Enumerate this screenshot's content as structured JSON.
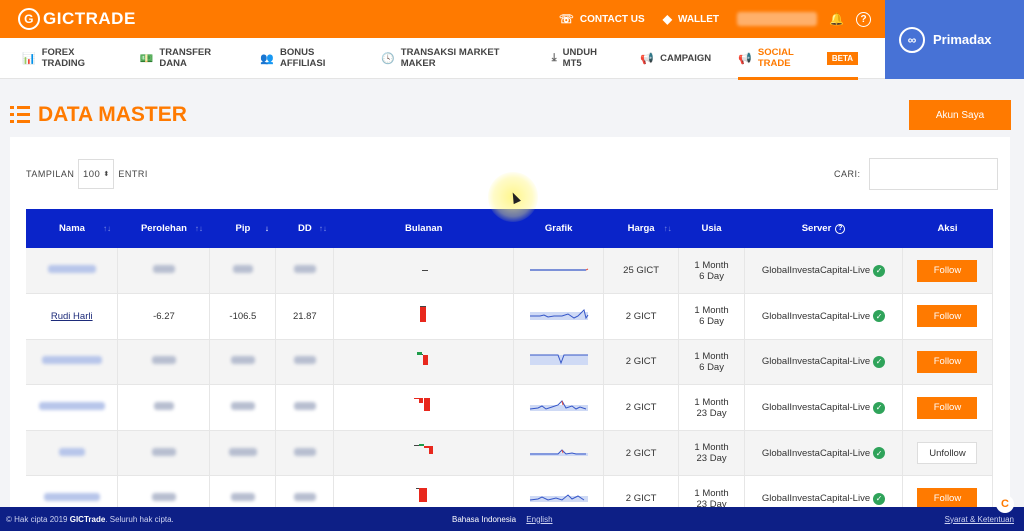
{
  "brand": {
    "logo_text": "GICTRADE",
    "accent": "#ff7a00",
    "table_header_bg": "#0a24c9"
  },
  "topbar": {
    "contact_label": "CONTACT US",
    "wallet_label": "WALLET"
  },
  "primadax": {
    "label": "Primadax"
  },
  "nav": [
    {
      "label": "FOREX TRADING",
      "icon": "chart-icon",
      "glyph": "📊"
    },
    {
      "label": "TRANSFER DANA",
      "icon": "money-icon",
      "glyph": "💵"
    },
    {
      "label": "BONUS AFFILIASI",
      "icon": "users-icon",
      "glyph": "👥"
    },
    {
      "label": "TRANSAKSI MARKET MAKER",
      "icon": "history-icon",
      "glyph": "🕓"
    },
    {
      "label": "UNDUH MT5",
      "icon": "download-icon",
      "glyph": "⤓"
    },
    {
      "label": "CAMPAIGN",
      "icon": "megaphone-icon",
      "glyph": "📢"
    },
    {
      "label": "SOCIAL TRADE",
      "icon": "megaphone-icon",
      "glyph": "📢",
      "badge": "BETA",
      "active": true
    }
  ],
  "page": {
    "title": "DATA MASTER",
    "account_button": "Akun Saya"
  },
  "controls": {
    "show_label": "TAMPILAN",
    "page_size": "100",
    "entries_label": "ENTRI",
    "search_label": "CARI:"
  },
  "table": {
    "columns": [
      "Nama",
      "Perolehan",
      "Pip",
      "DD",
      "Bulanan",
      "Grafik",
      "Harga",
      "Usia",
      "Server",
      "Aksi"
    ],
    "rows": [
      {
        "name": "",
        "perolehan": "",
        "pip": "",
        "dd": "",
        "price": "25 GICT",
        "age_1": "1 Month",
        "age_2": "6 Day",
        "server": "GlobalInvestaCapital-Live",
        "action": "Follow"
      },
      {
        "name": "Rudi Harli",
        "perolehan": "-6.27",
        "pip": "-106.5",
        "dd": "21.87",
        "price": "2 GICT",
        "age_1": "1 Month",
        "age_2": "6 Day",
        "server": "GlobalInvestaCapital-Live",
        "action": "Follow"
      },
      {
        "name": "",
        "perolehan": "",
        "pip": "",
        "dd": "",
        "price": "2 GICT",
        "age_1": "1 Month",
        "age_2": "6 Day",
        "server": "GlobalInvestaCapital-Live",
        "action": "Follow"
      },
      {
        "name": "",
        "perolehan": "",
        "pip": "",
        "dd": "",
        "price": "2 GICT",
        "age_1": "1 Month",
        "age_2": "23 Day",
        "server": "GlobalInvestaCapital-Live",
        "action": "Follow"
      },
      {
        "name": "",
        "perolehan": "",
        "pip": "",
        "dd": "",
        "price": "2 GICT",
        "age_1": "1 Month",
        "age_2": "23 Day",
        "server": "GlobalInvestaCapital-Live",
        "action": "Unfollow"
      },
      {
        "name": "",
        "perolehan": "",
        "pip": "",
        "dd": "",
        "price": "2 GICT",
        "age_1": "1 Month",
        "age_2": "23 Day",
        "server": "GlobalInvestaCapital-Live",
        "action": "Follow"
      }
    ]
  },
  "footer": {
    "copyright_prefix": "© Hak cipta 2019 ",
    "copyright_brand": "GICTrade",
    "copyright_suffix": ". Seluruh hak cipta.",
    "lang_id": "Bahasa Indonesia",
    "lang_en": "English",
    "terms": "Syarat & Ketentuan"
  }
}
